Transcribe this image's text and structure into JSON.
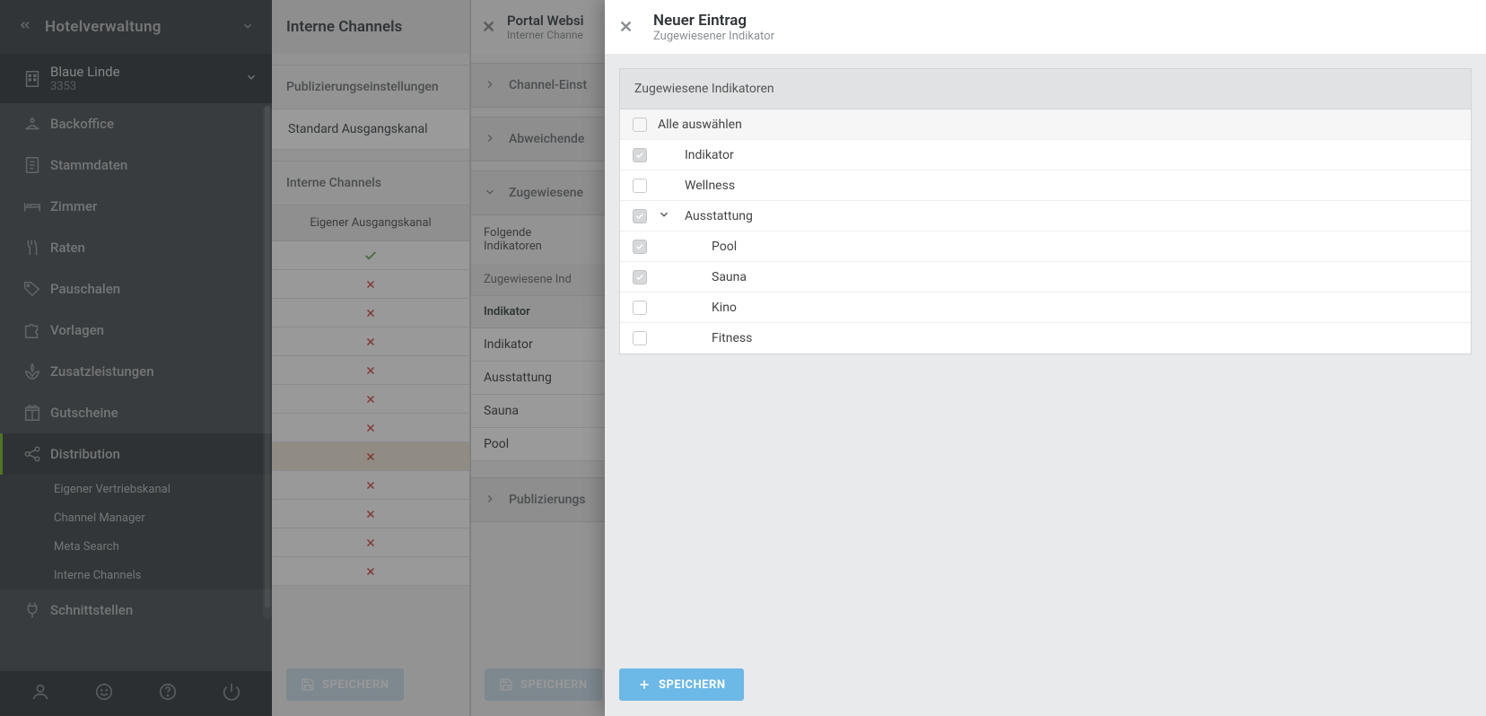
{
  "sidebar": {
    "appTitle": "Hotelverwaltung",
    "hotel": {
      "name": "Blaue Linde",
      "id": "3353"
    },
    "nav": [
      {
        "icon": "bell",
        "label": "Backoffice"
      },
      {
        "icon": "doc",
        "label": "Stammdaten"
      },
      {
        "icon": "bed",
        "label": "Zimmer"
      },
      {
        "icon": "fork",
        "label": "Raten"
      },
      {
        "icon": "tag",
        "label": "Pauschalen"
      },
      {
        "icon": "puzzle",
        "label": "Vorlagen"
      },
      {
        "icon": "spa",
        "label": "Zusatzleistungen"
      },
      {
        "icon": "gift",
        "label": "Gutscheine"
      },
      {
        "icon": "share",
        "label": "Distribution"
      },
      {
        "icon": "plug",
        "label": "Schnittstellen"
      }
    ],
    "subnav": [
      "Eigener Vertriebskanal",
      "Channel Manager",
      "Meta Search",
      "Interne Channels"
    ]
  },
  "panel1": {
    "title": "Interne Channels",
    "section1Title": "Publizierungseinstellungen",
    "section1Item": "Standard Ausgangskanal",
    "section2Title": "Interne Channels",
    "columnHeader": "Eigener Ausgangskanal",
    "rows": [
      {
        "status": "check"
      },
      {
        "status": "x"
      },
      {
        "status": "x"
      },
      {
        "status": "x"
      },
      {
        "status": "x"
      },
      {
        "status": "x"
      },
      {
        "status": "x"
      },
      {
        "status": "x",
        "highlight": true
      },
      {
        "status": "x"
      },
      {
        "status": "x"
      },
      {
        "status": "x"
      },
      {
        "status": "x"
      }
    ],
    "saveLabel": "SPEICHERN"
  },
  "panel2": {
    "title": "Portal Websi",
    "subtitle": "Interner Channe",
    "accordions": [
      {
        "label": "Channel-Einst",
        "open": false
      },
      {
        "label": "Abweichende",
        "open": false
      },
      {
        "label": "Zugewiesene",
        "open": true
      },
      {
        "label": "Publizierungs",
        "open": false
      }
    ],
    "desc": "Folgende Indikatoren",
    "groupHeader": "Zugewiesene Ind",
    "indHeader": "Indikator",
    "indRows": [
      "Indikator",
      "Ausstattung",
      "Sauna",
      "Pool"
    ],
    "saveLabel": "SPEICHERN"
  },
  "modal": {
    "title": "Neuer Eintrag",
    "subtitle": "Zugewiesener Indikator",
    "sectionHeader": "Zugewiesene Indikatoren",
    "selectAllLabel": "Alle auswählen",
    "items": [
      {
        "label": "Indikator",
        "checked": true,
        "indent": 0,
        "expandable": false
      },
      {
        "label": "Wellness",
        "checked": false,
        "indent": 0,
        "expandable": false
      },
      {
        "label": "Ausstattung",
        "checked": true,
        "indent": 0,
        "expandable": true
      },
      {
        "label": "Pool",
        "checked": true,
        "indent": 1,
        "expandable": false
      },
      {
        "label": "Sauna",
        "checked": true,
        "indent": 1,
        "expandable": false
      },
      {
        "label": "Kino",
        "checked": false,
        "indent": 1,
        "expandable": false
      },
      {
        "label": "Fitness",
        "checked": false,
        "indent": 1,
        "expandable": false
      }
    ],
    "saveLabel": "SPEICHERN"
  }
}
